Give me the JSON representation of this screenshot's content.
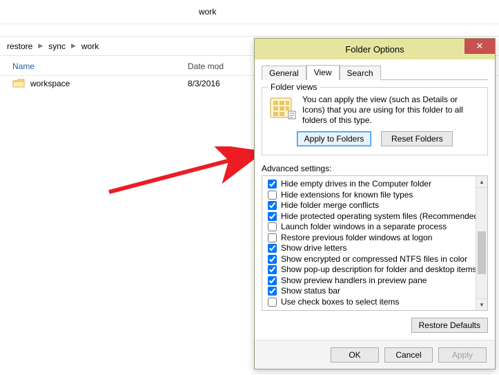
{
  "explorer": {
    "title": "work",
    "breadcrumb": [
      "restore",
      "sync",
      "work"
    ],
    "columns": {
      "name": "Name",
      "date": "Date mod"
    },
    "rows": [
      {
        "name": "workspace",
        "date": "8/3/2016"
      }
    ]
  },
  "dialog": {
    "title": "Folder Options",
    "tabs": [
      "General",
      "View",
      "Search"
    ],
    "active_tab": "View",
    "folder_views": {
      "legend": "Folder views",
      "text": "You can apply the view (such as Details or Icons) that you are using for this folder to all folders of this type.",
      "apply": "Apply to Folders",
      "reset": "Reset Folders"
    },
    "advanced_label": "Advanced settings:",
    "advanced": [
      {
        "label": "Hide empty drives in the Computer folder",
        "checked": true
      },
      {
        "label": "Hide extensions for known file types",
        "checked": false
      },
      {
        "label": "Hide folder merge conflicts",
        "checked": true
      },
      {
        "label": "Hide protected operating system files (Recommended)",
        "checked": true
      },
      {
        "label": "Launch folder windows in a separate process",
        "checked": false
      },
      {
        "label": "Restore previous folder windows at logon",
        "checked": false
      },
      {
        "label": "Show drive letters",
        "checked": true
      },
      {
        "label": "Show encrypted or compressed NTFS files in color",
        "checked": true
      },
      {
        "label": "Show pop-up description for folder and desktop items",
        "checked": true
      },
      {
        "label": "Show preview handlers in preview pane",
        "checked": true
      },
      {
        "label": "Show status bar",
        "checked": true
      },
      {
        "label": "Use check boxes to select items",
        "checked": false
      }
    ],
    "restore_defaults": "Restore Defaults",
    "buttons": {
      "ok": "OK",
      "cancel": "Cancel",
      "apply": "Apply"
    }
  }
}
